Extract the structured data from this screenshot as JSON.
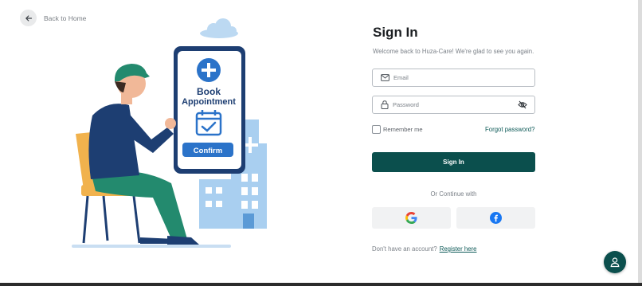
{
  "back": {
    "label": "Back to Home",
    "icon": "arrow-left-icon"
  },
  "illustration": {
    "line1": "Book",
    "line2": "Appointment",
    "confirm": "Confirm",
    "colors": {
      "phone_frame": "#1d3e72",
      "accent_blue": "#2b73c9",
      "building": "#a9cff0",
      "chair": "#f1b24d",
      "pants": "#238a6e",
      "shirt": "#1d3e72"
    }
  },
  "form": {
    "title": "Sign In",
    "subtitle": "Welcome back to Huza-Care! We're glad to see you again.",
    "email_placeholder": "Email",
    "password_placeholder": "Password",
    "remember_label": "Remember me",
    "forgot_label": "Forgot password?",
    "signin_label": "Sign In",
    "or_label": "Or Continue with",
    "register_text": "Don't have an account?",
    "register_link": "Register here"
  },
  "colors": {
    "primary": "#0b4f4d",
    "link": "#0e5a58",
    "muted": "#7b8188"
  }
}
